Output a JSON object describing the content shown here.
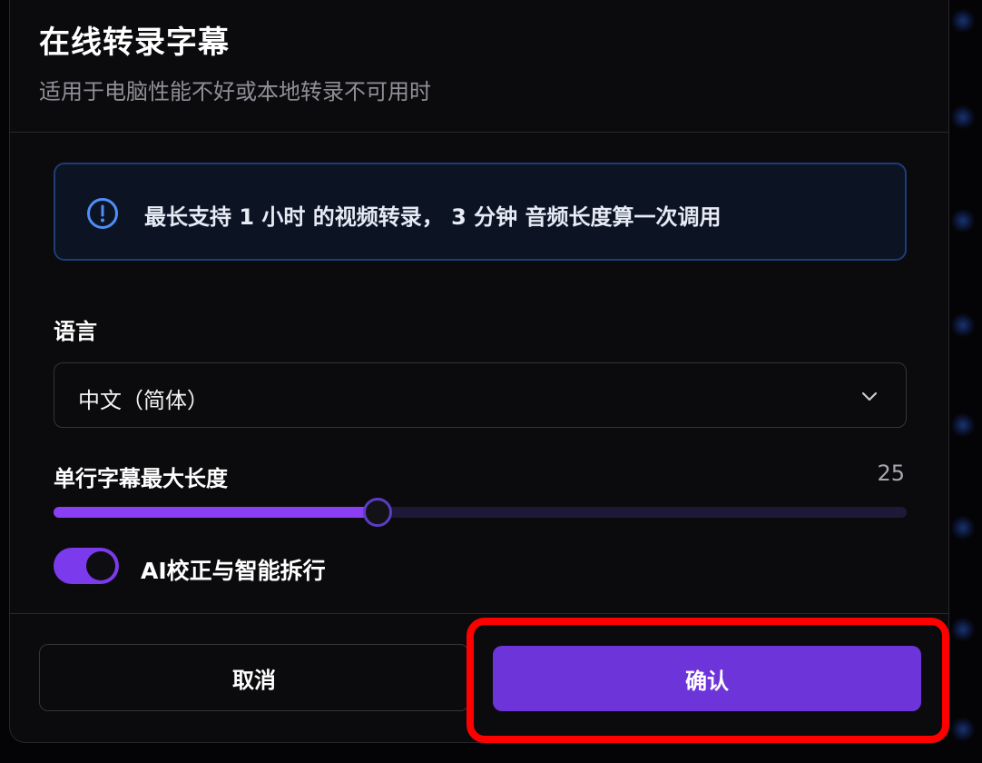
{
  "dialog": {
    "title": "在线转录字幕",
    "subtitle": "适用于电脑性能不好或本地转录不可用时"
  },
  "notice": {
    "icon": "info-icon",
    "text": "最长支持 1 小时 的视频转录， 3 分钟 音频长度算一次调用",
    "accent_color": "#4f8ef7"
  },
  "language": {
    "label": "语言",
    "selected": "中文（简体）",
    "icon": "chevron-down-icon"
  },
  "subtitle_length": {
    "label": "单行字幕最大长度",
    "value": "25",
    "slider_fraction": 0.38
  },
  "ai_correction": {
    "label": "AI校正与智能拆行",
    "enabled": true
  },
  "buttons": {
    "cancel_label": "取消",
    "confirm_label": "确认"
  },
  "colors": {
    "accent": "#7c3aed",
    "confirm": "#6d35d9",
    "highlight": "#ff0000"
  }
}
